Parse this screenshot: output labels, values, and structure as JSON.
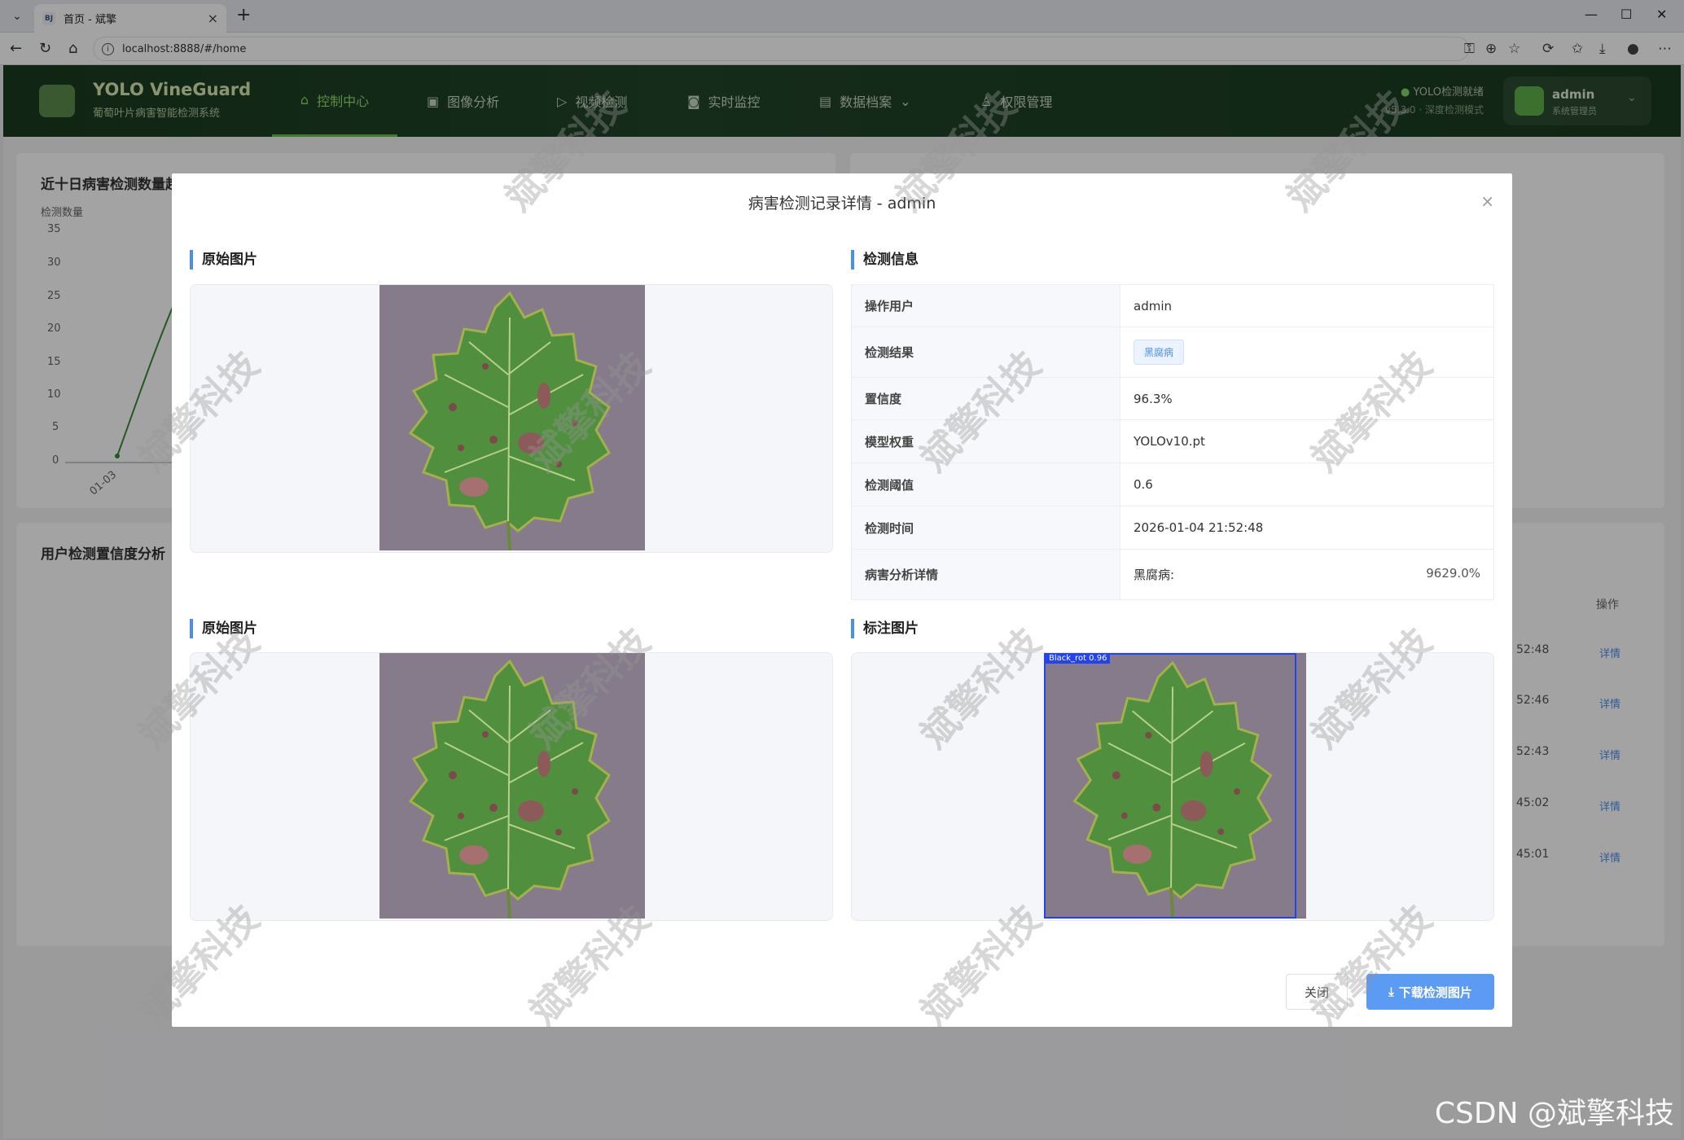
{
  "browser": {
    "tab_title": "首页 - 斌擎",
    "tab_favicon": "BJ",
    "url": "localhost:8888/#/home"
  },
  "app": {
    "brand": "YOLO VineGuard",
    "brand_sub": "葡萄叶片病害智能检测系统",
    "nav": [
      {
        "label": "控制中心",
        "icon": "home-icon",
        "active": true
      },
      {
        "label": "图像分析",
        "icon": "image-icon",
        "active": false
      },
      {
        "label": "视频检测",
        "icon": "play-icon",
        "active": false
      },
      {
        "label": "实时监控",
        "icon": "camera-icon",
        "active": false
      },
      {
        "label": "数据档案",
        "icon": "document-icon",
        "active": false
      },
      {
        "label": "权限管理",
        "icon": "user-icon",
        "active": false
      }
    ],
    "status_text": "YOLO检测就绪",
    "status_sub": "v5.3.0 · 深度检测模式",
    "user_name": "admin",
    "user_role": "系统管理员"
  },
  "background": {
    "trend_title": "近十日病害检测数量趋势",
    "trend_ylabel": "检测数量",
    "trend_ticks": [
      "35",
      "30",
      "25",
      "20",
      "15",
      "10",
      "5",
      "0"
    ],
    "trend_xtick": "01-03",
    "confidence_title": "用户检测置信度分析",
    "table_op_header": "操作",
    "table_times": [
      "52:48",
      "52:46",
      "52:43",
      "45:02",
      "45:01"
    ],
    "table_link": "详情"
  },
  "modal": {
    "title": "病害检测记录详情 - admin",
    "section_original": "原始图片",
    "section_info": "检测信息",
    "section_original2": "原始图片",
    "section_annotated": "标注图片",
    "info_rows": [
      {
        "label": "操作用户",
        "value": "admin"
      },
      {
        "label": "检测结果",
        "value": "黑腐病"
      },
      {
        "label": "置信度",
        "value": "96.3%"
      },
      {
        "label": "模型权重",
        "value": "YOLOv10.pt"
      },
      {
        "label": "检测阈值",
        "value": "0.6"
      },
      {
        "label": "检测时间",
        "value": "2026-01-04 21:52:48"
      },
      {
        "label": "病害分析详情",
        "value": "黑腐病:",
        "extra": "9629.0%"
      }
    ],
    "bbox_label": "Black_rot 0.96",
    "close_button": "关闭",
    "download_button": "下载检测图片"
  },
  "watermark": "斌擎科技",
  "csdn": "CSDN @斌擎科技",
  "colors": {
    "accent": "#4a8ff0",
    "header_green": "#1f4023",
    "active_nav": "#8ed96d"
  }
}
